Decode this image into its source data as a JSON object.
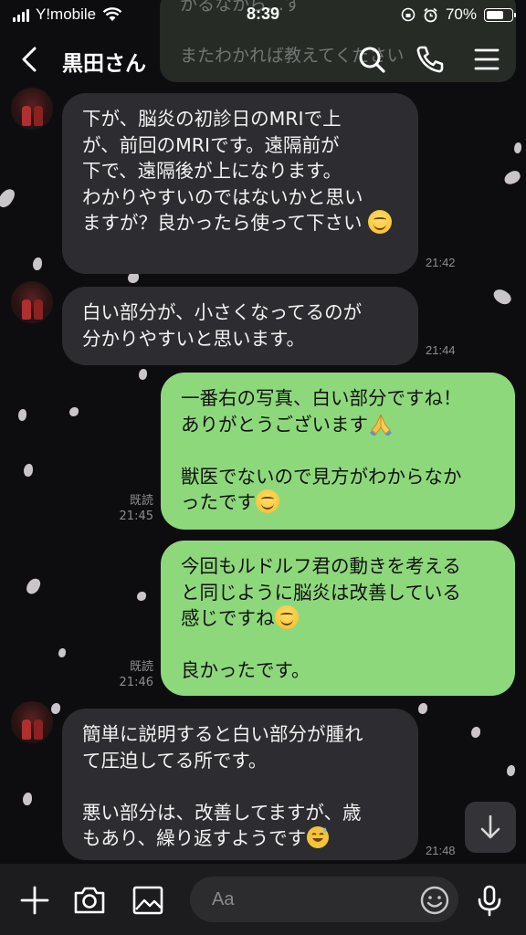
{
  "status_bar": {
    "carrier": "Y!mobile",
    "time": "8:39",
    "battery": "70%",
    "battery_level": 0.7
  },
  "header": {
    "title": "黒田さん"
  },
  "notification_peek": {
    "line1": "かるなから…す",
    "line2": "またわかれば教えてください"
  },
  "messages": [
    {
      "side": "in",
      "text": "下が、脳炎の初診日のMRIで上\nが、前回のMRIです。遠隔前が\n下で、遠隔後が上になります。\nわかりやすいのではないかと思い\nますが？良かったら使って下さい",
      "time": "21:42"
    },
    {
      "side": "in",
      "text": "白い部分が、小さくなってるのが\n分かりやすいと思います。",
      "time": "21:44"
    },
    {
      "side": "out",
      "text": "一番右の写真、白い部分ですね！\nありがとうございます",
      "text2": "\n\n獣医でないので見方がわからなか\nったです",
      "read": "既読",
      "time": "21:45"
    },
    {
      "side": "out",
      "text": "今回もルドルフ君の動きを考える\nと同じように脳炎は改善している\n感じですね",
      "text2": "\n\n良かったです。",
      "read": "既読",
      "time": "21:46"
    },
    {
      "side": "in",
      "text": "簡単に説明すると白い部分が腫れ\nて圧迫してる所です。\n\n悪い部分は、改善してますが、歳\nもあり、繰り返すようです",
      "time": "21:48"
    }
  ],
  "input": {
    "placeholder": "Aa"
  },
  "colors": {
    "background": "#0d0d0f",
    "incoming_bubble": "#2d2d31",
    "outgoing_bubble": "#8ed87c"
  },
  "icons": [
    "back-chevron-icon",
    "search-icon",
    "phone-icon",
    "menu-icon",
    "plus-icon",
    "camera-icon",
    "image-icon",
    "emoji-icon",
    "mic-icon",
    "arrow-down-icon"
  ]
}
